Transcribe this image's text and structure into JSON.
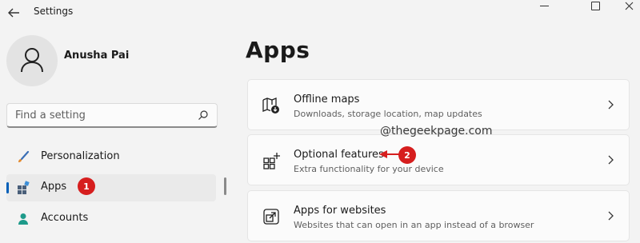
{
  "window": {
    "title": "Settings"
  },
  "user": {
    "name": "Anusha Pai"
  },
  "search": {
    "placeholder": "Find a setting"
  },
  "nav": {
    "items": [
      {
        "label": "Personalization",
        "icon": "brush-icon"
      },
      {
        "label": "Apps",
        "icon": "apps-icon",
        "active": true
      },
      {
        "label": "Accounts",
        "icon": "person-icon"
      }
    ]
  },
  "annotations": {
    "badge1": "1",
    "badge2": "2",
    "watermark": "@thegeekpage.com"
  },
  "main": {
    "heading": "Apps",
    "cards": [
      {
        "title": "Offline maps",
        "subtitle": "Downloads, storage location, map updates",
        "icon": "map-download-icon"
      },
      {
        "title": "Optional features",
        "subtitle": "Extra functionality for your device",
        "icon": "add-grid-icon"
      },
      {
        "title": "Apps for websites",
        "subtitle": "Websites that can open in an app instead of a browser",
        "icon": "open-window-icon"
      }
    ]
  },
  "colors": {
    "accent": "#005fb8",
    "annotation": "#d61e1e",
    "background": "#f3f3f3",
    "card": "#fbfbfb"
  }
}
